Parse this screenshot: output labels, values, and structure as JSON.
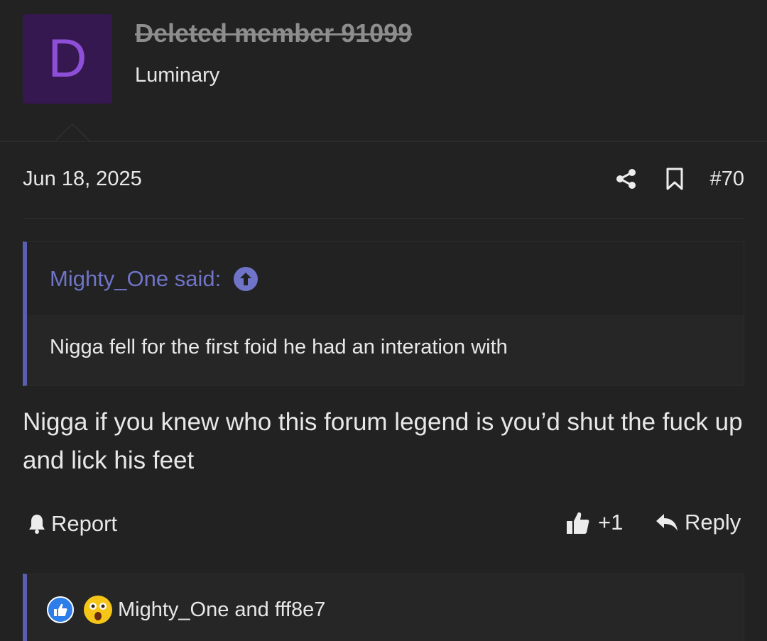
{
  "user": {
    "avatar_letter": "D",
    "name": "Deleted member 91099",
    "title": "Luminary",
    "avatar_bg": "#35184f",
    "avatar_fg": "#8e4fd8"
  },
  "post": {
    "date": "Jun 18, 2025",
    "number": "#70",
    "share_icon": "share-icon",
    "bookmark_icon": "bookmark-icon"
  },
  "quote": {
    "author": "Mighty_One said:",
    "text": "Nigga fell for the first foid he had an interation with",
    "accent": "#5a5fb0"
  },
  "body": {
    "text": "Nigga if you knew who this forum legend is you’d shut the fuck up and lick his feet"
  },
  "actions": {
    "report_label": "Report",
    "like_count": "+1",
    "reply_label": "Reply"
  },
  "reactions": {
    "users": "Mighty_One and fff8e7",
    "icons": [
      "like-reaction-icon",
      "wow-reaction-icon"
    ]
  }
}
